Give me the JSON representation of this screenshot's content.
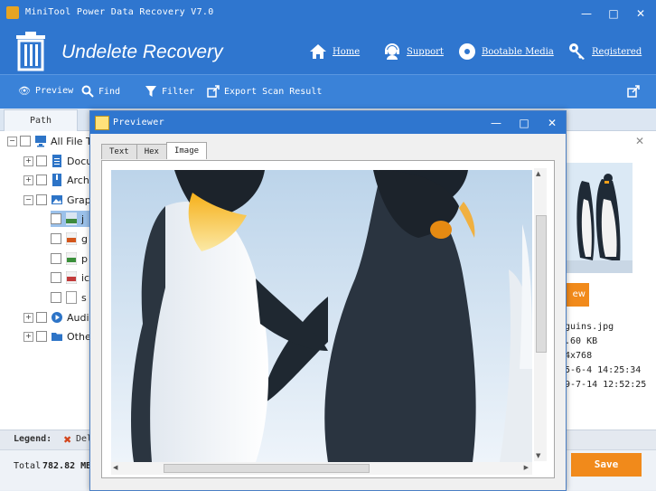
{
  "window": {
    "title": "MiniTool Power Data Recovery V7.0"
  },
  "header": {
    "product_title": "Undelete Recovery",
    "nav": {
      "home": "Home",
      "support": "Support",
      "bootable": "Bootable Media",
      "registered": "Registered"
    }
  },
  "toolbar": {
    "preview": "Preview",
    "find": "Find",
    "filter": "Filter",
    "export": "Export Scan Result"
  },
  "left_panel": {
    "tab_path": "Path",
    "tree": [
      {
        "label": "All File T"
      },
      {
        "label": "Docu"
      },
      {
        "label": "Archi"
      },
      {
        "label": "Grap"
      },
      {
        "label": "j"
      },
      {
        "label": "g"
      },
      {
        "label": "p"
      },
      {
        "label": "ic"
      },
      {
        "label": "s"
      },
      {
        "label": "Audi"
      },
      {
        "label": "Othe"
      }
    ]
  },
  "detail": {
    "preview_label": "ew",
    "filename": "guins.jpg",
    "size": ".60 KB",
    "dimension": "4x768",
    "created": "5-6-4 14:25:34",
    "modified": "9-7-14 12:52:25"
  },
  "legend": {
    "label": "Legend:",
    "deleted": "Del"
  },
  "total": {
    "label": "Total",
    "value": "782.82 MB"
  },
  "save_button": "Save",
  "previewer": {
    "title": "Previewer",
    "tabs": [
      "Text",
      "Hex",
      "Image"
    ],
    "active_tab": "Image"
  },
  "colors": {
    "brand_blue": "#2f76cf",
    "accent_orange": "#f18a1b"
  }
}
